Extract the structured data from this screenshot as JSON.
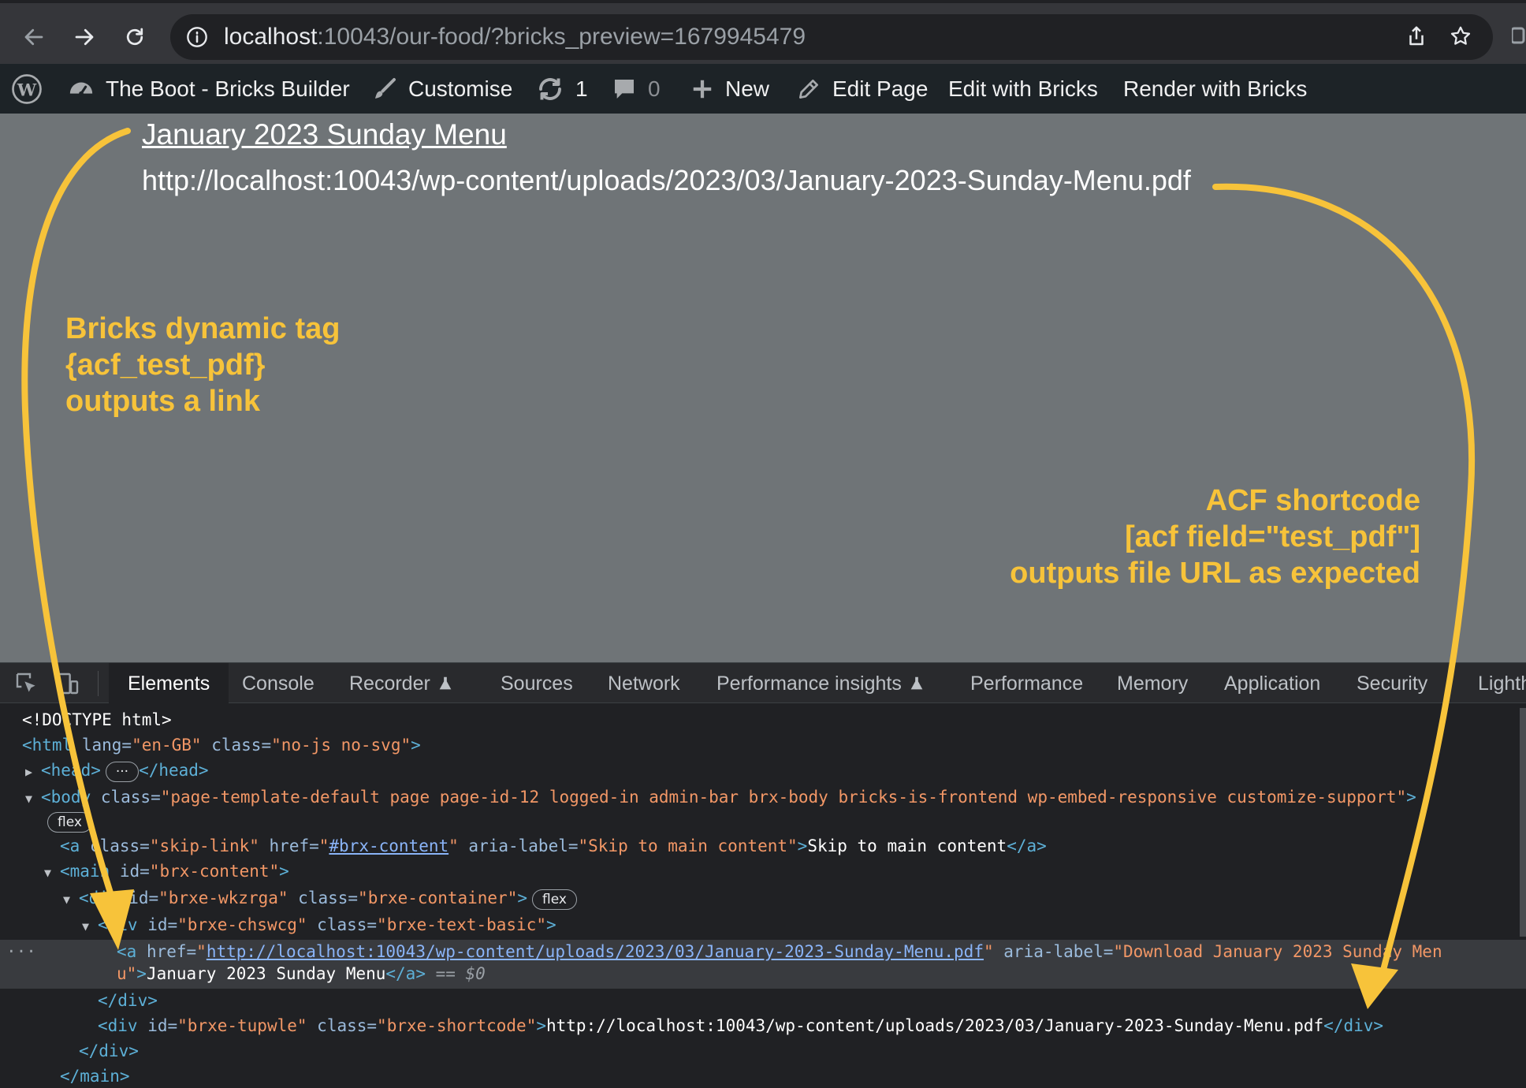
{
  "browser": {
    "url_host": "localhost",
    "url_rest": ":10043/our-food/?bricks_preview=1679945479"
  },
  "admin_bar": {
    "site_name": "The Boot - Bricks Builder",
    "customise": "Customise",
    "updates_count": "1",
    "comments_count": "0",
    "new": "New",
    "edit_page": "Edit Page",
    "edit_with_bricks": "Edit with Bricks",
    "render_with_bricks": "Render with Bricks"
  },
  "page": {
    "link_text": "January 2023 Sunday Menu",
    "shortcode_output": "http://localhost:10043/wp-content/uploads/2023/03/January-2023-Sunday-Menu.pdf"
  },
  "annotations": {
    "left": [
      "Bricks dynamic tag",
      "{acf_test_pdf}",
      "outputs a link"
    ],
    "right": [
      "ACF shortcode",
      "[acf field=\"test_pdf\"]",
      "outputs file URL as expected"
    ],
    "color": "#f7c33a"
  },
  "devtools": {
    "tabs": [
      "Elements",
      "Console",
      "Recorder",
      "Sources",
      "Network",
      "Performance insights",
      "Performance",
      "Memory",
      "Application",
      "Security",
      "Lighth"
    ],
    "dom": {
      "doctype": "<!DOCTYPE html>",
      "html_open": "<html",
      "html_lang_attr": " lang=",
      "html_lang_val": "\"en-GB\"",
      "html_class_attr": " class=",
      "html_class_val": "\"no-js no-svg\"",
      "gt": ">",
      "head_open": "<head>",
      "head_close": "</head>",
      "ellipsis": "···",
      "body_open": "<body",
      "class_attr": " class=",
      "body_class_val": "\"page-template-default page page-id-12 logged-in admin-bar brx-body bricks-is-frontend wp-embed-responsive customize-support\"",
      "flex_badge": "flex",
      "a_open": "<a",
      "skip_class_val": "\"skip-link\"",
      "href_attr": " href=",
      "skip_href_val": "#brx-content",
      "quote": "\"",
      "aria_attr": " aria-label=",
      "skip_aria_val": "\"Skip to main content\"",
      "skip_text": "Skip to main content",
      "a_close": "</a>",
      "main_open": "<main",
      "id_attr": " id=",
      "main_id_val": "\"brx-content\"",
      "div_open": "<div",
      "div1_id_val": "\"brxe-wkzrga\"",
      "div1_class_val": "\"brxe-container\"",
      "div2_id_val": "\"brxe-chswcg\"",
      "div2_class_val": "\"brxe-text-basic\"",
      "link_href_val": "http://localhost:10043/wp-content/uploads/2023/03/January-2023-Sunday-Menu.pdf",
      "link_aria_val_1": "\"Download January 2023 Sunday Men",
      "link_aria_val_2": "u\"",
      "link_text": "January 2023 Sunday Menu",
      "dollar_zero": " == $0",
      "div_close": "</div>",
      "div3_id_val": "\"brxe-tupwle\"",
      "div3_class_val": "\"brxe-shortcode\"",
      "div3_text": "http://localhost:10043/wp-content/uploads/2023/03/January-2023-Sunday-Menu.pdf",
      "main_close": "</main>",
      "ellipsis_dots": "···"
    }
  }
}
